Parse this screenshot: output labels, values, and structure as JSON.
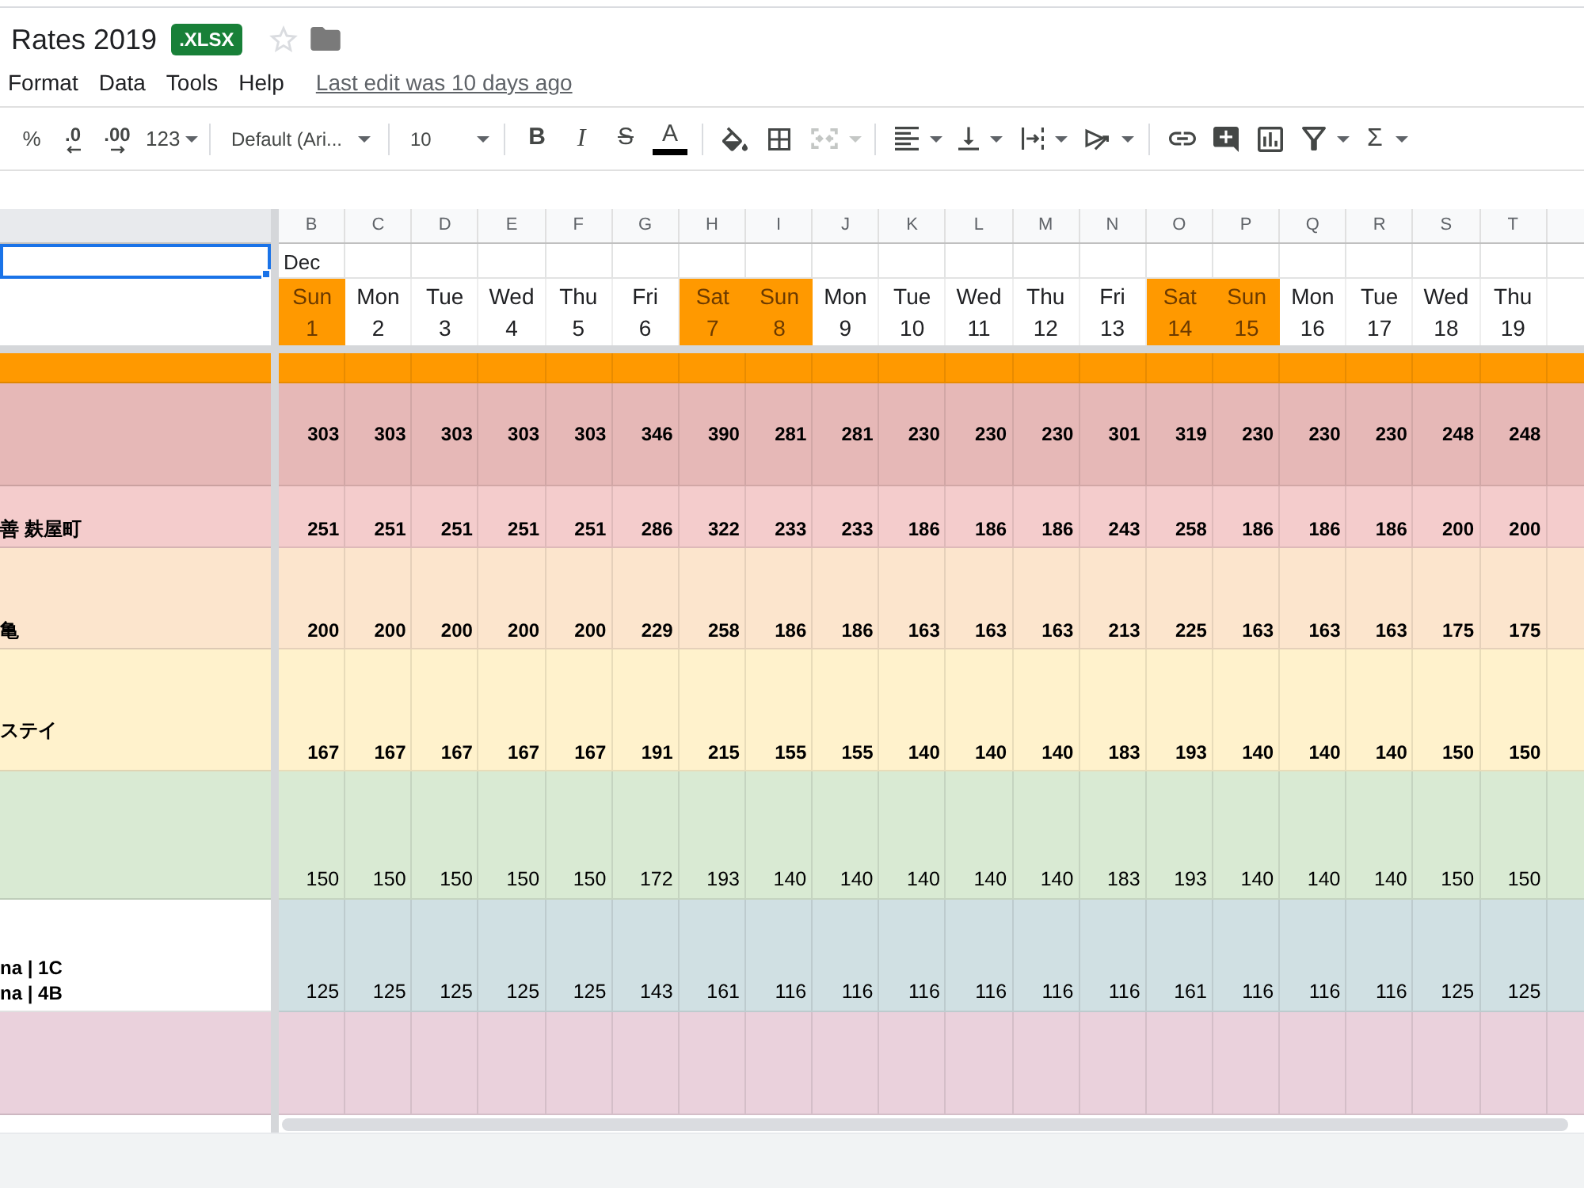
{
  "document": {
    "title": "Rates 2019",
    "badge": ".XLSX",
    "starred": false
  },
  "menu": [
    {
      "label": "Format"
    },
    {
      "label": "Data"
    },
    {
      "label": "Tools"
    },
    {
      "label": "Help"
    }
  ],
  "last_edit": "Last edit was 10 days ago",
  "toolbar": {
    "groups": [
      [
        {
          "kind": "text",
          "label": "%",
          "disabled": false
        },
        {
          "kind": "decrease_decimal",
          "label": ".0",
          "disabled": false
        },
        {
          "kind": "increase_decimal",
          "label": ".00",
          "disabled": false
        },
        {
          "kind": "number_format",
          "label": "123",
          "dropdown": true,
          "disabled": false
        }
      ],
      [
        {
          "kind": "font",
          "label": "Default (Ari...",
          "dropdown": true,
          "disabled": false
        }
      ],
      [
        {
          "kind": "font_size",
          "label": "10",
          "dropdown": true,
          "disabled": false
        }
      ],
      [
        {
          "kind": "bold",
          "label": "B",
          "disabled": false
        },
        {
          "kind": "italic",
          "label": "I",
          "disabled": false
        },
        {
          "kind": "strikethrough",
          "label": "S",
          "disabled": false
        },
        {
          "kind": "text_color",
          "label": "A",
          "disabled": false
        }
      ],
      [
        {
          "kind": "fill_color",
          "disabled": false
        },
        {
          "kind": "borders",
          "disabled": false
        },
        {
          "kind": "merge",
          "dropdown": true,
          "disabled": true
        }
      ],
      [
        {
          "kind": "align",
          "dropdown": true,
          "disabled": false
        },
        {
          "kind": "vertical_align",
          "dropdown": true,
          "disabled": false
        },
        {
          "kind": "wrap",
          "dropdown": true,
          "disabled": false
        },
        {
          "kind": "rotate",
          "dropdown": true,
          "disabled": false
        }
      ],
      [
        {
          "kind": "link",
          "disabled": false
        },
        {
          "kind": "comment",
          "disabled": false
        },
        {
          "kind": "chart",
          "disabled": false
        },
        {
          "kind": "filter",
          "dropdown": true,
          "disabled": false
        },
        {
          "kind": "functions",
          "label": "Σ",
          "dropdown": true,
          "disabled": false
        }
      ]
    ]
  },
  "sheet": {
    "name_cell": {
      "selected": true
    },
    "columns": [
      "B",
      "C",
      "D",
      "E",
      "F",
      "G",
      "H",
      "I",
      "J",
      "K",
      "L",
      "M",
      "N",
      "O",
      "P",
      "Q",
      "R",
      "S",
      "T"
    ],
    "month": "Dec",
    "days": [
      {
        "weekday": "Sun",
        "date": "1",
        "weekend": true
      },
      {
        "weekday": "Mon",
        "date": "2",
        "weekend": false
      },
      {
        "weekday": "Tue",
        "date": "3",
        "weekend": false
      },
      {
        "weekday": "Wed",
        "date": "4",
        "weekend": false
      },
      {
        "weekday": "Thu",
        "date": "5",
        "weekend": false
      },
      {
        "weekday": "Fri",
        "date": "6",
        "weekend": false
      },
      {
        "weekday": "Sat",
        "date": "7",
        "weekend": true
      },
      {
        "weekday": "Sun",
        "date": "8",
        "weekend": true
      },
      {
        "weekday": "Mon",
        "date": "9",
        "weekend": false
      },
      {
        "weekday": "Tue",
        "date": "10",
        "weekend": false
      },
      {
        "weekday": "Wed",
        "date": "11",
        "weekend": false
      },
      {
        "weekday": "Thu",
        "date": "12",
        "weekend": false
      },
      {
        "weekday": "Fri",
        "date": "13",
        "weekend": false
      },
      {
        "weekday": "Sat",
        "date": "14",
        "weekend": true
      },
      {
        "weekday": "Sun",
        "date": "15",
        "weekend": true
      },
      {
        "weekday": "Mon",
        "date": "16",
        "weekend": false
      },
      {
        "weekday": "Tue",
        "date": "17",
        "weekend": false
      },
      {
        "weekday": "Wed",
        "date": "18",
        "weekend": false
      },
      {
        "weekday": "Thu",
        "date": "19",
        "weekend": false
      }
    ],
    "rows": [
      {
        "color": "#ff9900",
        "label_filled": true
      },
      {
        "color": "#e6b8b7",
        "label_filled": true,
        "bold": true,
        "values": [
          "303",
          "303",
          "303",
          "303",
          "303",
          "346",
          "390",
          "281",
          "281",
          "230",
          "230",
          "230",
          "301",
          "319",
          "230",
          "230",
          "230",
          "248",
          "248"
        ]
      },
      {
        "color": "#f4cccc",
        "label_filled": true,
        "label_lines": [
          "善 麸屋町"
        ],
        "bold": true,
        "values": [
          "251",
          "251",
          "251",
          "251",
          "251",
          "286",
          "322",
          "233",
          "233",
          "186",
          "186",
          "186",
          "243",
          "258",
          "186",
          "186",
          "186",
          "200",
          "200"
        ]
      },
      {
        "color": "#fce5cd",
        "label_filled": true,
        "label_lines": [
          "亀"
        ],
        "bold": true,
        "values": [
          "200",
          "200",
          "200",
          "200",
          "200",
          "229",
          "258",
          "186",
          "186",
          "163",
          "163",
          "163",
          "213",
          "225",
          "163",
          "163",
          "163",
          "175",
          "175"
        ]
      },
      {
        "color": "#fff2cc",
        "label_filled": true,
        "label_lines": [
          "ステイ"
        ],
        "bold": true,
        "values": [
          "167",
          "167",
          "167",
          "167",
          "167",
          "191",
          "215",
          "155",
          "155",
          "140",
          "140",
          "140",
          "183",
          "193",
          "140",
          "140",
          "140",
          "150",
          "150"
        ]
      },
      {
        "color": "#d9ead3",
        "label_filled": true,
        "bold": false,
        "values": [
          "150",
          "150",
          "150",
          "150",
          "150",
          "172",
          "193",
          "140",
          "140",
          "140",
          "140",
          "140",
          "183",
          "193",
          "140",
          "140",
          "140",
          "150",
          "150"
        ]
      },
      {
        "color": "#d0e0e3",
        "label_filled": false,
        "label_lines": [
          "na | 1C",
          "na | 4B"
        ],
        "bold": false,
        "values": [
          "125",
          "125",
          "125",
          "125",
          "125",
          "143",
          "161",
          "116",
          "116",
          "116",
          "116",
          "116",
          "116",
          "161",
          "116",
          "116",
          "116",
          "125",
          "125"
        ]
      },
      {
        "color": "#ead1dc",
        "label_filled": true
      }
    ]
  }
}
